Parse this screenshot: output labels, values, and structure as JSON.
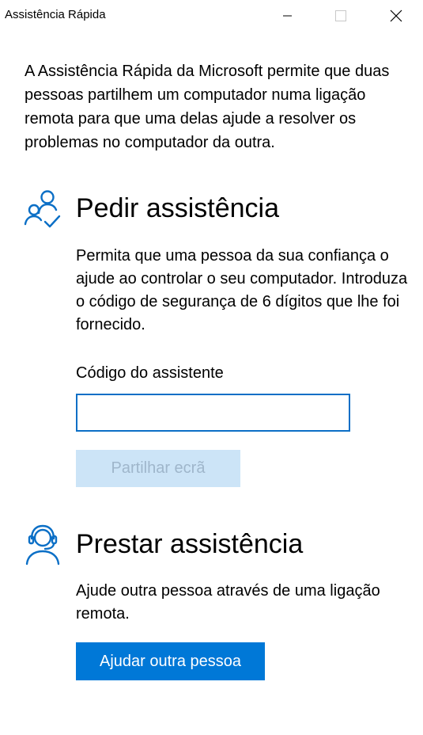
{
  "window": {
    "title": "Assistência Rápida"
  },
  "intro": {
    "text": "A Assistência Rápida da Microsoft permite que duas pessoas partilhem um computador numa ligação remota para que uma delas ajude a resolver os problemas no computador da outra."
  },
  "request": {
    "title": "Pedir assistência",
    "description": "Permita que uma pessoa da sua confiança o ajude ao controlar o seu computador. Introduza o código de segurança de 6 dígitos que lhe foi fornecido.",
    "code_label": "Código do assistente",
    "code_value": "",
    "share_button": "Partilhar ecrã",
    "share_enabled": false,
    "icon": "people-check-icon"
  },
  "give": {
    "title": "Prestar assistência",
    "description": "Ajude outra pessoa através de uma ligação remota.",
    "help_button": "Ajudar outra pessoa",
    "icon": "headset-person-icon"
  },
  "colors": {
    "accent": "#0078d7",
    "icon_blue": "#0b6fc6",
    "disabled_button_bg": "#cce4f7",
    "disabled_button_text": "#9fb6cb"
  }
}
